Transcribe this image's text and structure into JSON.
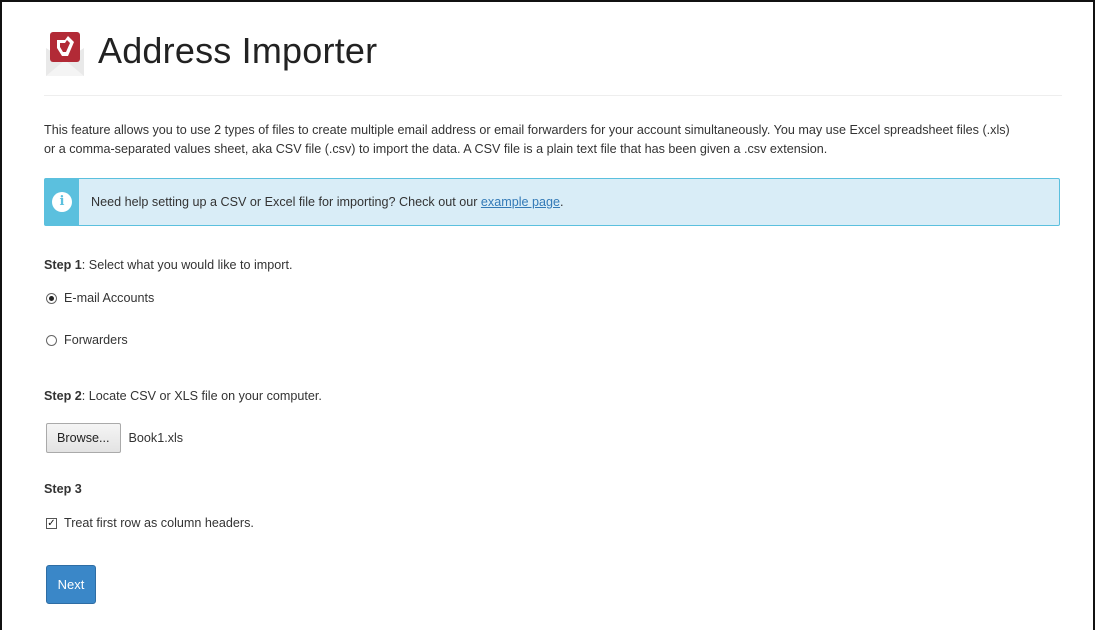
{
  "header": {
    "title": "Address Importer",
    "logo_icon": "envelope-logo-icon"
  },
  "intro": {
    "line1": "This feature allows you to use 2 types of files to create multiple email address or email forwarders for your account simultaneously. You may use Excel spreadsheet files (.xls)",
    "line2": "or a comma-separated values sheet, aka CSV file (.csv) to import the data. A CSV file is a plain text file that has been given a .csv extension."
  },
  "alert": {
    "icon": "info-icon",
    "text": "Need help setting up a CSV or Excel file for importing? Check out our ",
    "link_text": "example page",
    "suffix": "."
  },
  "step1": {
    "label": "Step 1",
    "text": ": Select what you would like to import.",
    "options": [
      {
        "label": "E-mail Accounts",
        "checked": true
      },
      {
        "label": "Forwarders",
        "checked": false
      }
    ]
  },
  "step2": {
    "label": "Step 2",
    "text": ": Locate CSV or XLS file on your computer.",
    "browse_label": "Browse...",
    "file_name": "Book1.xls"
  },
  "step3": {
    "label": "Step 3",
    "checkbox_label": "Treat first row as column headers.",
    "checked": true
  },
  "actions": {
    "next_label": "Next"
  },
  "colors": {
    "accent": "#3a87c8",
    "alert_bg": "#d9edf7",
    "alert_border": "#5bc0de",
    "logo_red": "#b22a36",
    "link": "#337ab7"
  }
}
